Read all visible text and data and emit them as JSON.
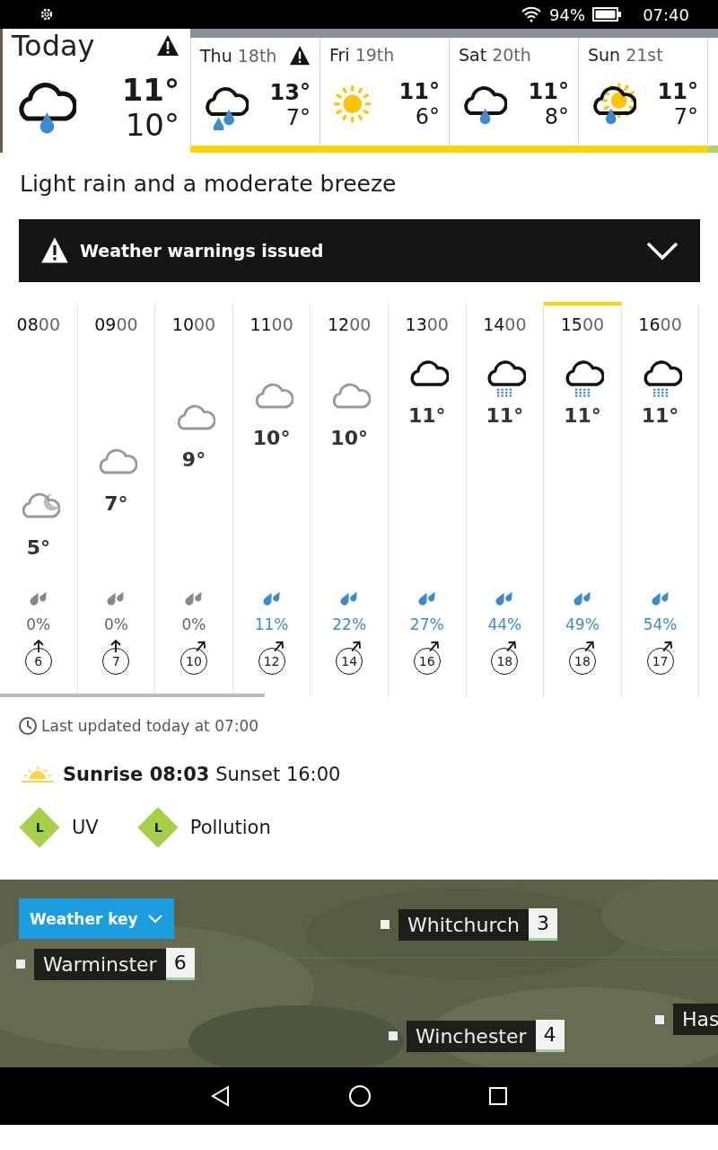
{
  "status_bar": {
    "battery": "94%",
    "time": "07:40"
  },
  "days": [
    {
      "day": "Today",
      "selected": true,
      "warning": true,
      "kind": "rain",
      "high": "11°",
      "low": "10°"
    },
    {
      "day": "Thu",
      "date": "18th",
      "selected": false,
      "warning": true,
      "kind": "heavy-rain",
      "high": "13°",
      "low": "7°"
    },
    {
      "day": "Fri",
      "date": "19th",
      "selected": false,
      "warning": false,
      "kind": "sun",
      "high": "11°",
      "low": "6°"
    },
    {
      "day": "Sat",
      "date": "20th",
      "selected": false,
      "warning": false,
      "kind": "rain",
      "high": "11°",
      "low": "8°"
    },
    {
      "day": "Sun",
      "date": "21st",
      "selected": false,
      "warning": false,
      "kind": "sun-rain",
      "high": "11°",
      "low": "7°"
    }
  ],
  "summary": "Light rain and a moderate breeze",
  "warning_bar": {
    "label": "Weather warnings issued",
    "expanded": false
  },
  "hours": [
    {
      "time": "**08**00",
      "kind": "cloud-moon",
      "temp": "5°",
      "rain": "0%",
      "wet": false,
      "wind": {
        "speed": "6",
        "kind": "north"
      },
      "selected": false
    },
    {
      "time": "**09**00",
      "kind": "light-cloud",
      "temp": "7°",
      "rain": "0%",
      "wet": false,
      "wind": {
        "speed": "7",
        "kind": "north"
      },
      "selected": false
    },
    {
      "time": "**10**00",
      "kind": "light-cloud",
      "temp": "9°",
      "rain": "0%",
      "wet": false,
      "wind": {
        "speed": "10",
        "kind": "northeast"
      },
      "selected": false
    },
    {
      "time": "**11**00",
      "kind": "light-cloud",
      "temp": "10°",
      "rain": "11%",
      "wet": true,
      "wind": {
        "speed": "12",
        "kind": "northeast"
      },
      "selected": false
    },
    {
      "time": "**12**00",
      "kind": "light-cloud",
      "temp": "10°",
      "rain": "22%",
      "wet": true,
      "wind": {
        "speed": "14",
        "kind": "northeast"
      },
      "selected": false
    },
    {
      "time": "**13**00",
      "kind": "cloud",
      "temp": "11°",
      "rain": "27%",
      "wet": true,
      "wind": {
        "speed": "16",
        "kind": "northeast"
      },
      "selected": false
    },
    {
      "time": "**14**00",
      "kind": "drizzle",
      "temp": "11°",
      "rain": "44%",
      "wet": true,
      "wind": {
        "speed": "18",
        "kind": "northeast"
      },
      "selected": false
    },
    {
      "time": "**15**00",
      "kind": "drizzle",
      "temp": "11°",
      "rain": "49%",
      "wet": true,
      "wind": {
        "speed": "18",
        "kind": "northeast"
      },
      "selected": true
    },
    {
      "time": "**16**00",
      "kind": "drizzle",
      "temp": "11°",
      "rain": "54%",
      "wet": true,
      "wind": {
        "speed": "17",
        "kind": "northeast"
      },
      "selected": false
    }
  ],
  "last_updated": "Last updated today at 07:00",
  "sun": "**Sunrise 08:03** Sunset 16:00",
  "indices": [
    {
      "level_label": "L",
      "label": "UV",
      "color": "#a6cf4a"
    },
    {
      "level_label": "L",
      "label": "Pollution",
      "color": "#a6cf4a"
    }
  ],
  "map": {
    "key_button": "Weather key",
    "places": [
      {
        "name": "Warminster",
        "value": "6"
      },
      {
        "name": "Whitchurch",
        "value": "3"
      },
      {
        "name": "Winchester",
        "value": "4"
      },
      {
        "name": "Has"
      }
    ]
  }
}
